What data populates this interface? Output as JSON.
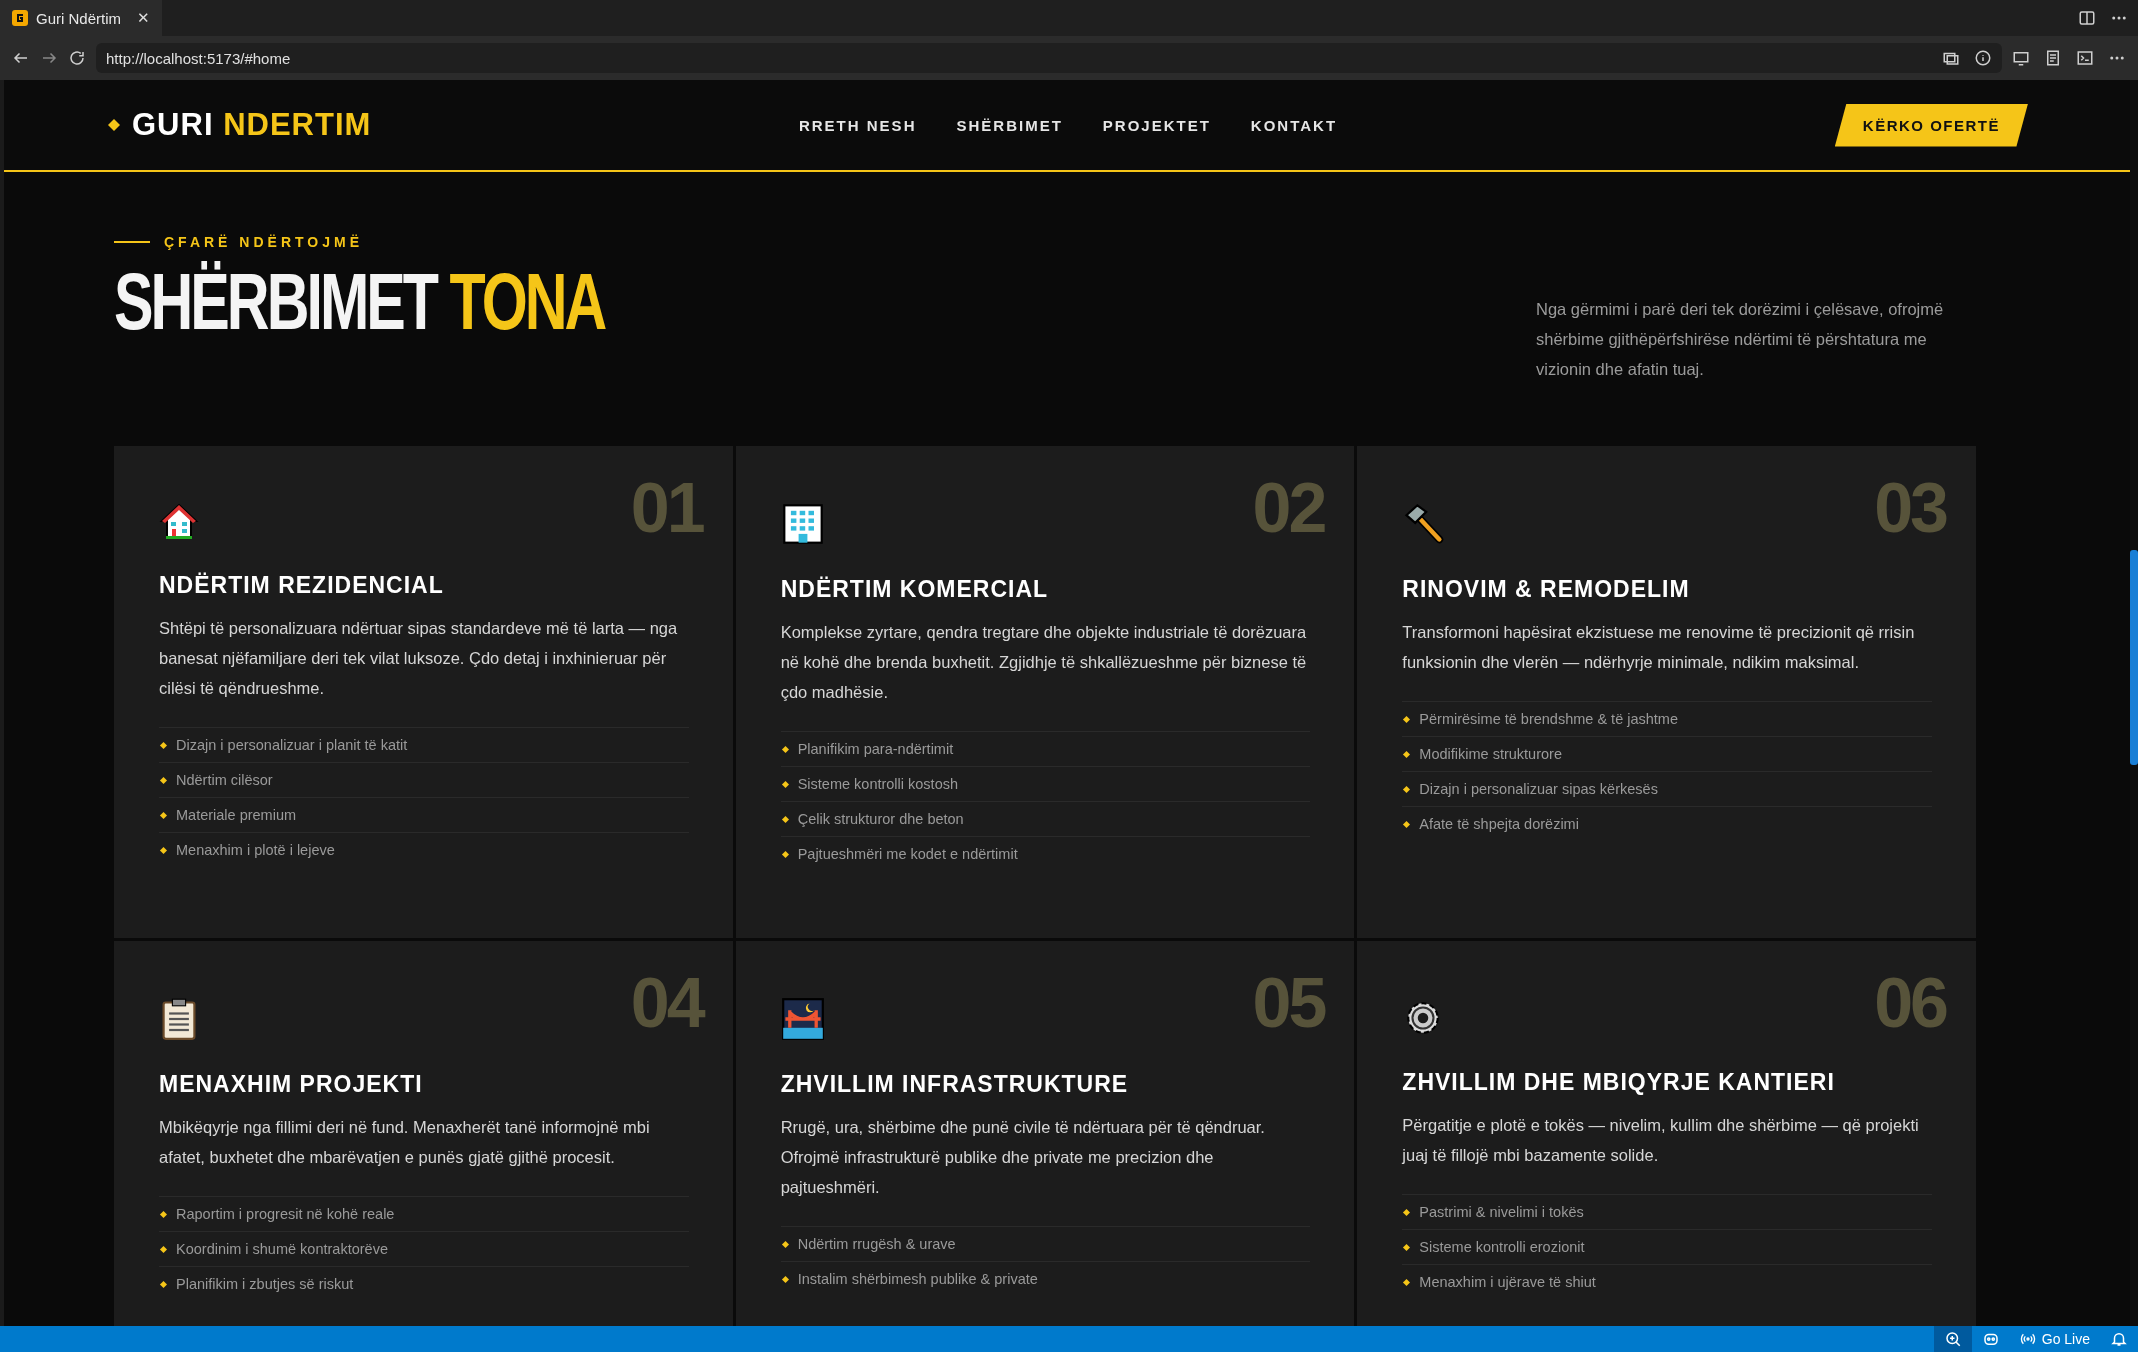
{
  "browser": {
    "tab_title": "Guri Ndërtim",
    "tab_close": "✕",
    "url": "http://localhost:5173/#home"
  },
  "nav": {
    "logo": [
      "GURI",
      "NDERTIM"
    ],
    "links": [
      "RRETH NESH",
      "SHËRBIMET",
      "PROJEKTET",
      "KONTAKT"
    ],
    "cta": "KËRKO OFERTË"
  },
  "section": {
    "eyebrow": "ÇFARË NDËRTOJMË",
    "title": [
      "SHËRBIMET",
      "TONA"
    ],
    "intro": "Nga gërmimi i parë deri tek dorëzimi i çelësave, ofrojmë shërbime gjithëpërfshirëse ndërtimi të përshtatura me vizionin dhe afatin tuaj."
  },
  "services": [
    {
      "number": "01",
      "title": "NDËRTIM REZIDENCIAL",
      "description": "Shtëpi të personalizuara ndërtuar sipas standardeve më të larta — nga banesat njëfamiljare deri tek vilat luksoze. Çdo detaj i inxhinieruar për cilësi të qëndrueshme.",
      "features": [
        "Dizajn i personalizuar i planit të katit",
        "Ndërtim cilësor",
        "Materiale premium",
        "Menaxhim i plotë i lejeve"
      ]
    },
    {
      "number": "02",
      "title": "NDËRTIM KOMERCIAL",
      "description": "Komplekse zyrtare, qendra tregtare dhe objekte industriale të dorëzuara në kohë dhe brenda buxhetit. Zgjidhje të shkallëzueshme për biznese të çdo madhësie.",
      "features": [
        "Planifikim para-ndërtimit",
        "Sisteme kontrolli kostosh",
        "Çelik strukturor dhe beton",
        "Pajtueshmëri me kodet e ndërtimit"
      ]
    },
    {
      "number": "03",
      "title": "RINOVIM & REMODELIM",
      "description": "Transformoni hapësirat ekzistuese me renovime të precizionit që rrisin funksionin dhe vlerën — ndërhyrje minimale, ndikim maksimal.",
      "features": [
        "Përmirësime të brendshme & të jashtme",
        "Modifikime strukturore",
        "Dizajn i personalizuar sipas kërkesës",
        "Afate të shpejta dorëzimi"
      ]
    },
    {
      "number": "04",
      "title": "MENAXHIM PROJEKTI",
      "description": "Mbikëqyrje nga fillimi deri në fund. Menaxherët tanë informojnë mbi afatet, buxhetet dhe mbarëvatjen e punës gjatë gjithë procesit.",
      "features": [
        "Raportim i progresit në kohë reale",
        "Koordinim i shumë kontraktorëve",
        "Planifikim i zbutjes së riskut"
      ]
    },
    {
      "number": "05",
      "title": "ZHVILLIM INFRASTRUKTURE",
      "description": "Rrugë, ura, shërbime dhe punë civile të ndërtuara për të qëndruar. Ofrojmë infrastrukturë publike dhe private me precizion dhe pajtueshmëri.",
      "features": [
        "Ndërtim rrugësh & urave",
        "Instalim shërbimesh publike & private"
      ]
    },
    {
      "number": "06",
      "title": "ZHVILLIM DHE MBIQYRJE KANTIERI",
      "description": "Përgatitje e plotë e tokës — nivelim, kullim dhe shërbime — që projekti juaj të fillojë mbi bazamente solide.",
      "features": [
        "Pastrimi & nivelimi i tokës",
        "Sisteme kontrolli erozionit",
        "Menaxhim i ujërave të shiut"
      ]
    }
  ],
  "status_bar": {
    "go_live": "Go Live"
  }
}
